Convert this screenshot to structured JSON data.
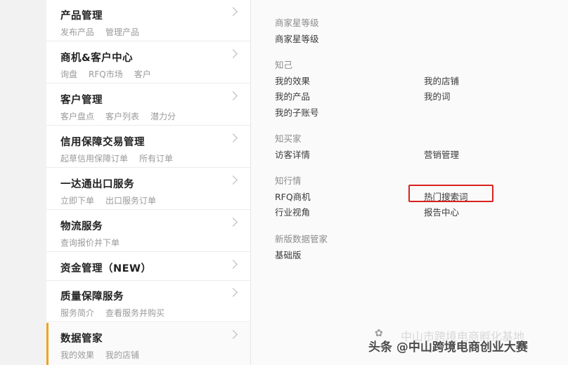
{
  "sidebar": {
    "items": [
      {
        "title": "产品管理",
        "subs": [
          "发布产品",
          "管理产品"
        ]
      },
      {
        "title": "商机&客户中心",
        "subs": [
          "询盘",
          "RFQ市场",
          "客户"
        ]
      },
      {
        "title": "客户管理",
        "subs": [
          "客户盘点",
          "客户列表",
          "潜力分"
        ]
      },
      {
        "title": "信用保障交易管理",
        "subs": [
          "起草信用保障订单",
          "所有订单"
        ]
      },
      {
        "title": "一达通出口服务",
        "subs": [
          "立即下单",
          "出口服务订单"
        ]
      },
      {
        "title": "物流服务",
        "subs": [
          "查询报价并下单"
        ]
      },
      {
        "title": "资金管理（NEW）",
        "subs": []
      },
      {
        "title": "质量保障服务",
        "subs": [
          "服务简介",
          "查看服务并购买"
        ]
      },
      {
        "title": "数据管家",
        "subs": [
          "我的效果",
          "我的店铺"
        ],
        "active": true
      }
    ]
  },
  "panel": {
    "sections": [
      {
        "heading": "商家星等级",
        "links": [
          "商家星等级"
        ]
      },
      {
        "heading": "知己",
        "links": [
          "我的效果",
          "我的店铺",
          "我的产品",
          "我的词",
          "我的子账号"
        ]
      },
      {
        "heading": "知买家",
        "links": [
          "访客详情",
          "营销管理"
        ]
      },
      {
        "heading": "知行情",
        "links": [
          "RFQ商机",
          "热门搜索词",
          "行业视角",
          "报告中心"
        ]
      },
      {
        "heading": "新版数据管家",
        "links": [
          "基础版"
        ]
      }
    ],
    "highlighted_link": "热门搜索词"
  },
  "watermark": {
    "faint_text": "中山市跨境电商孵化基地",
    "text": "头条 @中山跨境电商创业大赛"
  },
  "colors": {
    "active_bar": "#f0a21c",
    "highlight_box": "#d9221f"
  }
}
